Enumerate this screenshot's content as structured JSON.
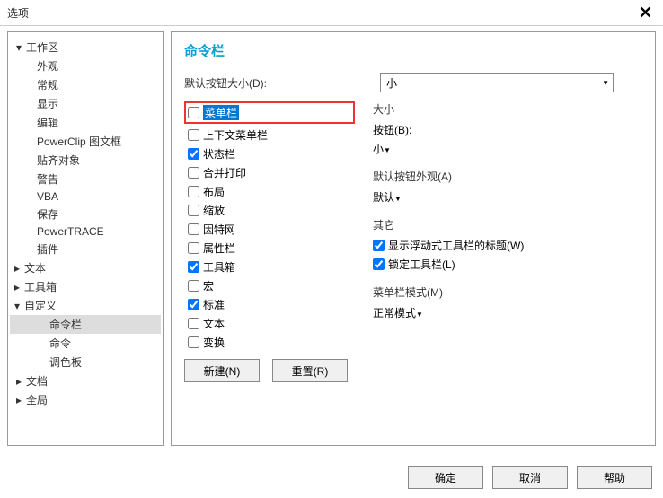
{
  "title": "选项",
  "close": "✕",
  "tree": {
    "workspace": {
      "label": "工作区",
      "expanded": true
    },
    "workspace_items": [
      "外观",
      "常规",
      "显示",
      "编辑",
      "PowerClip 图文框",
      "贴齐对象",
      "警告",
      "VBA",
      "保存",
      "PowerTRACE",
      "插件"
    ],
    "text": {
      "label": "文本",
      "expanded": false
    },
    "toolbox": {
      "label": "工具箱",
      "expanded": false
    },
    "customize": {
      "label": "自定义",
      "expanded": true
    },
    "customize_items": [
      "命令栏",
      "命令",
      "调色板"
    ],
    "document": {
      "label": "文档",
      "expanded": false
    },
    "global": {
      "label": "全局",
      "expanded": false
    }
  },
  "panel_title": "命令栏",
  "default_size_label": "默认按钮大小(D):",
  "default_size_value": "小",
  "checklist": [
    {
      "label": "菜单栏",
      "checked": false,
      "highlight": true
    },
    {
      "label": "上下文菜单栏",
      "checked": false
    },
    {
      "label": "状态栏",
      "checked": true
    },
    {
      "label": "合并打印",
      "checked": false
    },
    {
      "label": "布局",
      "checked": false
    },
    {
      "label": "缩放",
      "checked": false
    },
    {
      "label": "因特网",
      "checked": false
    },
    {
      "label": "属性栏",
      "checked": false
    },
    {
      "label": "工具箱",
      "checked": true
    },
    {
      "label": "宏",
      "checked": false
    },
    {
      "label": "标准",
      "checked": true
    },
    {
      "label": "文本",
      "checked": false
    },
    {
      "label": "变换",
      "checked": false
    }
  ],
  "size_group": {
    "title": "大小",
    "button_label": "按钮(B):",
    "button_value": "小"
  },
  "appearance_group": {
    "title": "默认按钮外观(A)",
    "value": "默认"
  },
  "other_group": {
    "title": "其它",
    "show_float_title": {
      "label": "显示浮动式工具栏的标题(W)",
      "checked": true
    },
    "lock_toolbar": {
      "label": "锁定工具栏(L)",
      "checked": true
    }
  },
  "menubar_mode": {
    "title": "菜单栏模式(M)",
    "value": "正常模式"
  },
  "buttons": {
    "new": "新建(N)",
    "reset": "重置(R)",
    "ok": "确定",
    "cancel": "取消",
    "help": "帮助"
  }
}
